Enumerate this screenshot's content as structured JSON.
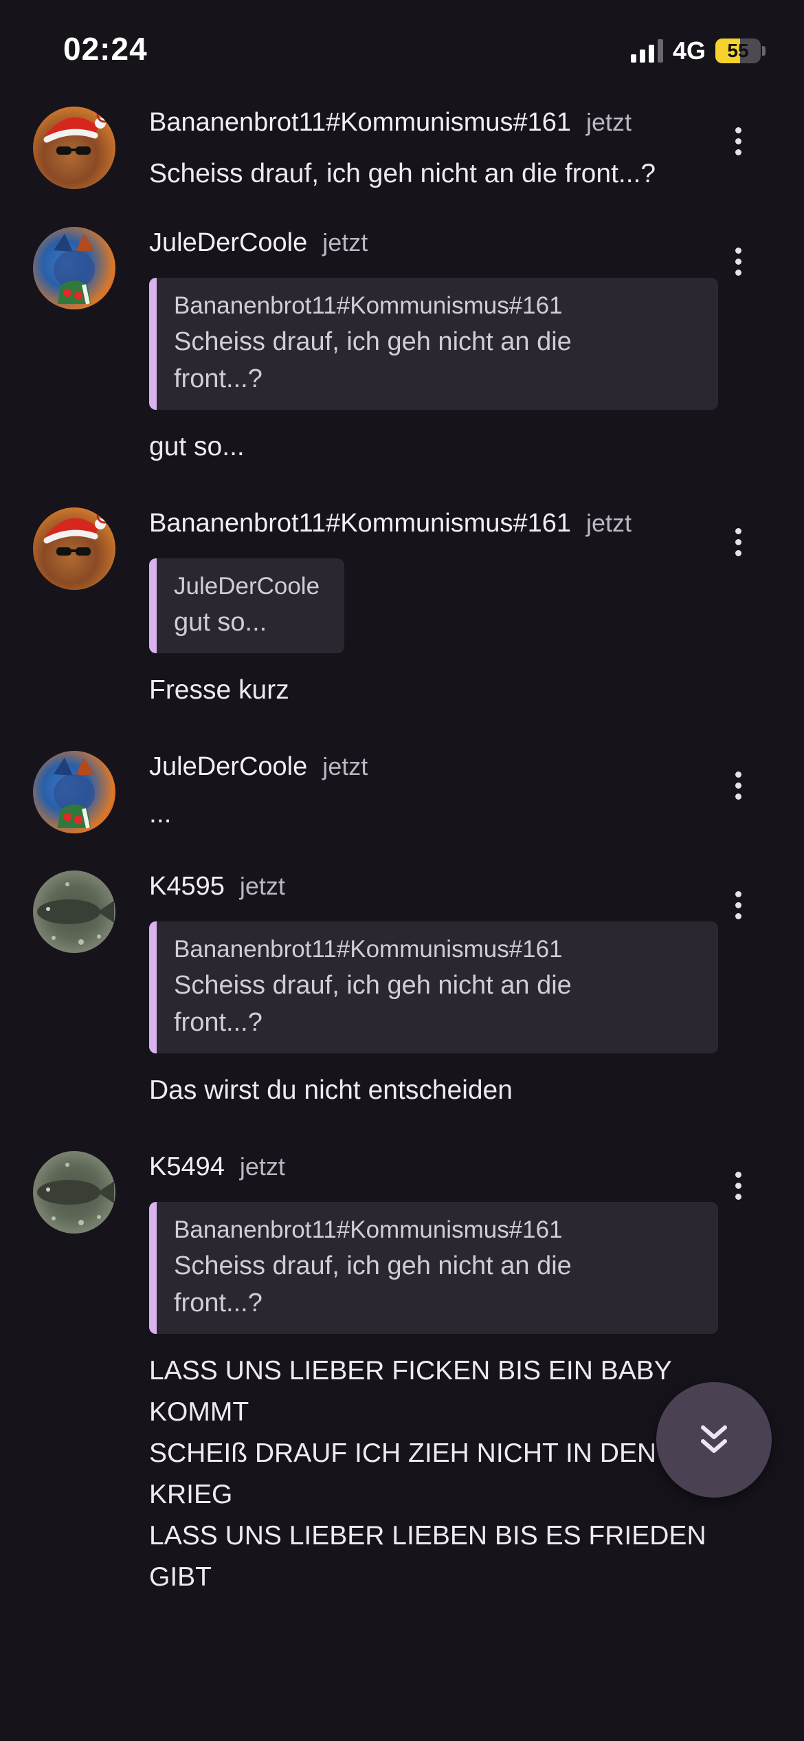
{
  "status_bar": {
    "time": "02:24",
    "network": "4G",
    "battery_level": "55",
    "battery_fraction": 0.55,
    "signal_bars_active": 3,
    "signal_bars_total": 4
  },
  "colors": {
    "background": "#16131a",
    "quote_bar": "#d8b3f0",
    "quote_bg": "#2b2731",
    "battery": "#f7d12e",
    "fab": "#4a4253"
  },
  "messages": [
    {
      "author": "Bananenbrot11#Kommunismus#161",
      "time": "jetzt",
      "avatar": "santa-bread-avatar",
      "text": "Scheiss drauf, ich geh nicht an die front...?"
    },
    {
      "author": "JuleDerCoole",
      "time": "jetzt",
      "avatar": "christmas-wolf-avatar",
      "quote": {
        "author": "Bananenbrot11#Kommunismus#161",
        "text": "Scheiss drauf, ich geh nicht an die front...?"
      },
      "text": "gut so..."
    },
    {
      "author": "Bananenbrot11#Kommunismus#161",
      "time": "jetzt",
      "avatar": "santa-bread-avatar",
      "quote": {
        "author": "JuleDerCoole",
        "text": "gut so..."
      },
      "text": "Fresse kurz"
    },
    {
      "author": "JuleDerCoole",
      "time": "jetzt",
      "avatar": "christmas-wolf-avatar",
      "text": "..."
    },
    {
      "author": "K4595",
      "time": "jetzt",
      "avatar": "fish-avatar",
      "quote": {
        "author": "Bananenbrot11#Kommunismus#161",
        "text": "Scheiss drauf, ich geh nicht an die front...?"
      },
      "text": "Das wirst du nicht entscheiden"
    },
    {
      "author": "K5494",
      "time": "jetzt",
      "avatar": "fish-avatar",
      "quote": {
        "author": "Bananenbrot11#Kommunismus#161",
        "text": "Scheiss drauf, ich geh nicht an die front...?"
      },
      "text": "LASS UNS LIEBER FICKEN BIS EIN BABY KOMMT\nSCHEIß DRAUF ICH ZIEH NICHT IN DEN KRIEG\nLASS UNS LIEBER LIEBEN BIS ES FRIEDEN GIBT"
    }
  ],
  "scroll_button_icon": "double-chevron-down-icon"
}
